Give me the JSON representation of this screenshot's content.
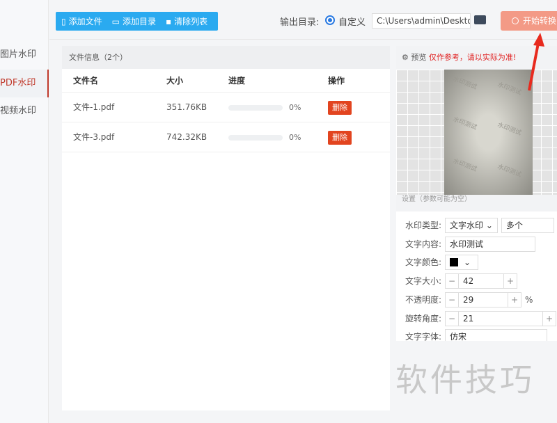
{
  "sidebar": {
    "items": [
      {
        "label": "图片水印"
      },
      {
        "label": "PDF水印"
      },
      {
        "label": "视频水印"
      }
    ]
  },
  "toolbar": {
    "add_file": "添加文件",
    "add_dir": "添加目录",
    "clear_list": "清除列表",
    "output_label": "输出目录:",
    "radio_label": "自定义",
    "output_path": "C:\\Users\\admin\\Deskto",
    "start": "开始转换"
  },
  "file_panel": {
    "title": "文件信息（2个）",
    "columns": [
      "文件名",
      "大小",
      "进度",
      "操作"
    ],
    "rows": [
      {
        "name": "文件-1.pdf",
        "size": "351.76KB",
        "progress": "0%",
        "action": "删除"
      },
      {
        "name": "文件-3.pdf",
        "size": "742.32KB",
        "progress": "0%",
        "action": "删除"
      }
    ]
  },
  "preview": {
    "title": "预览",
    "warning": "仅作参考，请以实际为准!",
    "watermark_text": "水印测试"
  },
  "settings": {
    "header": "设置（参数可能为空）",
    "type_label": "水印类型:",
    "type_value": "文字水印",
    "mode_value": "多个",
    "content_label": "文字内容:",
    "content_value": "水印测试",
    "color_label": "文字颜色:",
    "color": "#000000",
    "size_label": "文字大小:",
    "size_value": "42",
    "opacity_label": "不透明度:",
    "opacity_value": "29",
    "opacity_unit": "%",
    "rotate_label": "旋转角度:",
    "rotate_value": "21",
    "font_label": "文字字体:",
    "font_value": "仿宋"
  },
  "logo_text": "软件技巧"
}
